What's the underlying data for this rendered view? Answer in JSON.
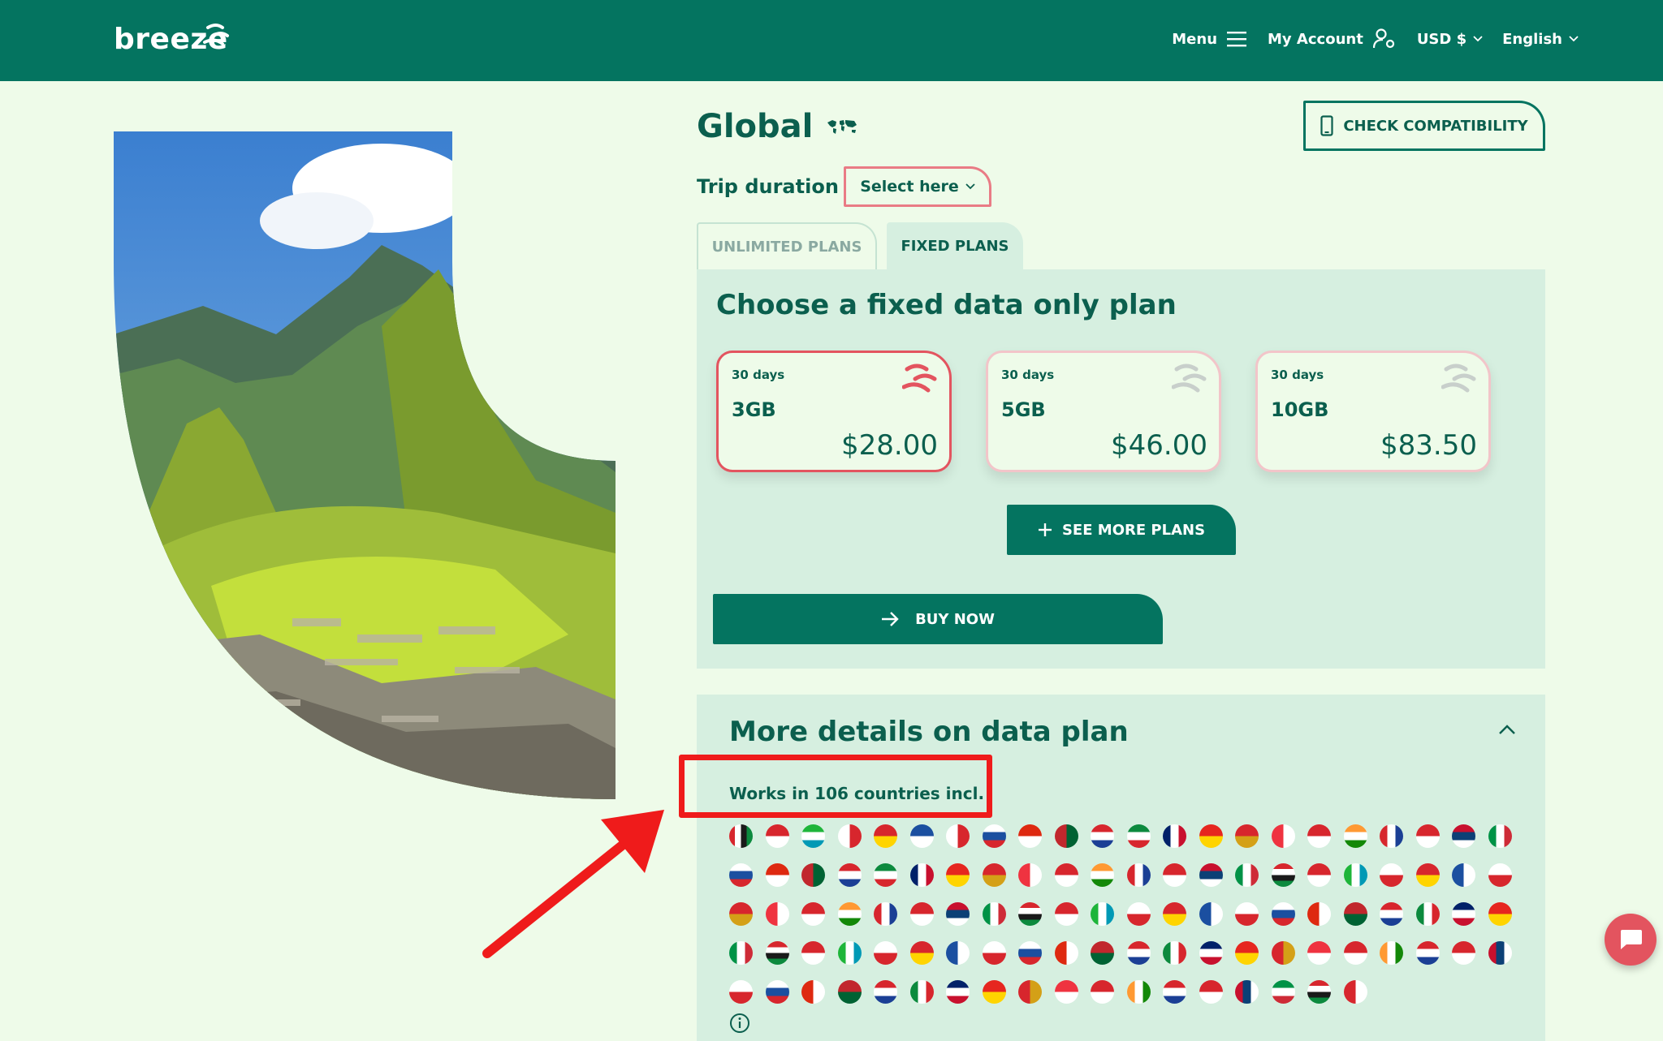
{
  "header": {
    "logo_text": "breeze",
    "menu_label": "Menu",
    "account_label": "My Account",
    "currency_label": "USD $",
    "language_label": "English"
  },
  "product": {
    "title": "Global",
    "check_compat_label": "CHECK COMPATIBILITY",
    "trip_duration_label": "Trip duration",
    "select_label": "Select here"
  },
  "tabs": [
    {
      "label": "UNLIMITED PLANS",
      "active": false
    },
    {
      "label": "FIXED PLANS",
      "active": true
    }
  ],
  "plans_panel": {
    "heading": "Choose a fixed data only plan",
    "plans": [
      {
        "days": "30 days",
        "size": "3GB",
        "price": "$28.00",
        "selected": true
      },
      {
        "days": "30 days",
        "size": "5GB",
        "price": "$46.00",
        "selected": false
      },
      {
        "days": "30 days",
        "size": "10GB",
        "price": "$83.50",
        "selected": false
      }
    ],
    "see_more_label": "SEE MORE PLANS",
    "buy_now_label": "BUY NOW"
  },
  "details": {
    "heading": "More details on data plan",
    "works_in": "Works in 106 countries incl."
  },
  "colors": {
    "brand": "#047460",
    "background": "#eefbe9",
    "panel": "#d6efe0",
    "accent_red": "#e3545f",
    "annotation_red": "#ef1b1b"
  }
}
